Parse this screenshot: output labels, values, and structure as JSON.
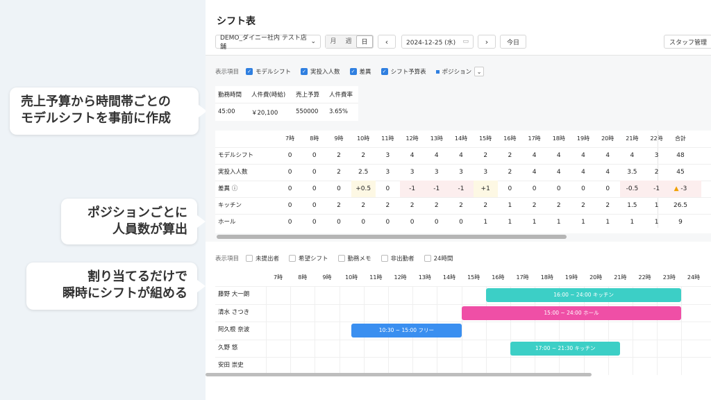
{
  "callouts": {
    "c1": [
      "売上予算から時間帯ごとの",
      "モデルシフトを事前に作成"
    ],
    "c2": [
      "ポジションごとに",
      "人員数が算出"
    ],
    "c3": [
      "割り当てるだけで",
      "瞬時にシフトが組める"
    ]
  },
  "header": {
    "title": "シフト表",
    "store": "DEMO_ダイニー社内 テスト店舗",
    "view_tabs": [
      "月",
      "週",
      "日"
    ],
    "date": "2024-12-25 (水)",
    "today": "今日",
    "staff_mgmt": "スタッフ管理"
  },
  "filters": {
    "label": "表示項目",
    "items": [
      "モデルシフト",
      "実投入人数",
      "差異",
      "シフト予算表"
    ],
    "position": "ポジション"
  },
  "summary": {
    "headers": [
      "勤務時間",
      "人件費(時給)",
      "売上予算",
      "人件費率"
    ],
    "values": [
      "45:00",
      "￥20,100",
      "550000",
      "3.65%"
    ]
  },
  "hours": [
    "7時",
    "8時",
    "9時",
    "10時",
    "11時",
    "12時",
    "13時",
    "14時",
    "15時",
    "16時",
    "17時",
    "18時",
    "19時",
    "20時",
    "21時",
    "22時"
  ],
  "total_label": "合計",
  "rows": [
    {
      "label": "モデルシフト",
      "values": [
        "0",
        "0",
        "2",
        "2",
        "3",
        "4",
        "4",
        "4",
        "2",
        "2",
        "4",
        "4",
        "4",
        "4",
        "4",
        "3"
      ],
      "total": "48"
    },
    {
      "label": "実投入人数",
      "values": [
        "0",
        "0",
        "2",
        "2.5",
        "3",
        "3",
        "3",
        "3",
        "3",
        "2",
        "4",
        "4",
        "4",
        "4",
        "3.5",
        "2"
      ],
      "total": "45"
    },
    {
      "label": "差異 ⓘ",
      "values": [
        "0",
        "0",
        "0",
        "+0.5",
        "0",
        "-1",
        "-1",
        "-1",
        "+1",
        "0",
        "0",
        "0",
        "0",
        "0",
        "-0.5",
        "-1"
      ],
      "total": "▲ -3"
    },
    {
      "label": "キッチン",
      "values": [
        "0",
        "0",
        "2",
        "2",
        "2",
        "2",
        "2",
        "2",
        "2",
        "1",
        "2",
        "2",
        "2",
        "2",
        "1.5",
        "1"
      ],
      "total": "26.5"
    },
    {
      "label": "ホール",
      "values": [
        "0",
        "0",
        "0",
        "0",
        "0",
        "0",
        "0",
        "0",
        "1",
        "1",
        "1",
        "1",
        "1",
        "1",
        "1",
        "1"
      ],
      "total": "9"
    }
  ],
  "filters2": {
    "label": "表示項目",
    "items": [
      "未提出者",
      "希望シフト",
      "勤務メモ",
      "非出勤者",
      "24時間"
    ]
  },
  "hours2": [
    "7時",
    "8時",
    "9時",
    "10時",
    "11時",
    "12時",
    "13時",
    "14時",
    "15時",
    "16時",
    "17時",
    "18時",
    "19時",
    "20時",
    "21時",
    "22時",
    "23時",
    "24時"
  ],
  "staff": [
    {
      "name": "藤野 大一朗",
      "shift": "16:00 ~ 24:00 キッチン",
      "start": 16,
      "end": 24,
      "color": "#3ccfc6"
    },
    {
      "name": "清水 さつき",
      "shift": "15:00 ~ 24:00 ホール",
      "start": 15,
      "end": 24,
      "color": "#ef4fa6"
    },
    {
      "name": "阿久根 奈波",
      "shift": "10:30 ~ 15:00 フリー",
      "start": 10.5,
      "end": 15,
      "color": "#3a8ff0"
    },
    {
      "name": "久野 悠",
      "shift": "17:00 ~ 21:30 キッチン",
      "start": 17,
      "end": 21.5,
      "color": "#3ccfc6"
    },
    {
      "name": "安田 崇史",
      "shift": "",
      "start": 0,
      "end": 0,
      "color": ""
    }
  ]
}
